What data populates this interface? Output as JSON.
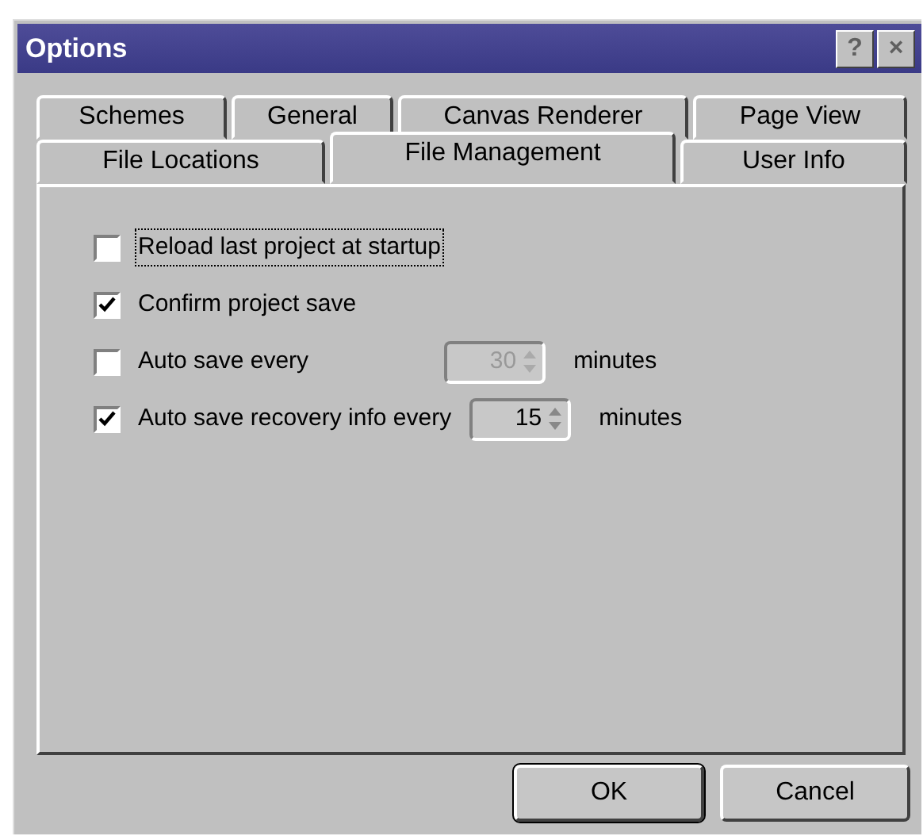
{
  "window": {
    "title": "Options",
    "title_buttons": [
      "?",
      "×"
    ]
  },
  "tab_rows": [
    [
      {
        "label": "Schemes",
        "selected": false
      },
      {
        "label": "General",
        "selected": false
      },
      {
        "label": "Canvas Renderer",
        "selected": false
      },
      {
        "label": "Page View",
        "selected": false
      }
    ],
    [
      {
        "label": "File Locations",
        "selected": false
      },
      {
        "label": "File Management",
        "selected": true
      },
      {
        "label": "User Info",
        "selected": false
      }
    ]
  ],
  "options": [
    {
      "label": "Reload last project at startup",
      "checked": false,
      "focused": true
    },
    {
      "label": "Confirm project save",
      "checked": true,
      "focused": false
    },
    {
      "label": "Auto save every",
      "checked": false,
      "focused": false,
      "spin": {
        "value": "30",
        "disabled": true,
        "unit": "minutes"
      }
    },
    {
      "label": "Auto save recovery info every",
      "checked": true,
      "focused": false,
      "spin": {
        "value": "15",
        "disabled": false,
        "unit": "minutes"
      }
    }
  ],
  "buttons": [
    {
      "label": "OK",
      "default": true
    },
    {
      "label": "Cancel",
      "default": false
    }
  ]
}
